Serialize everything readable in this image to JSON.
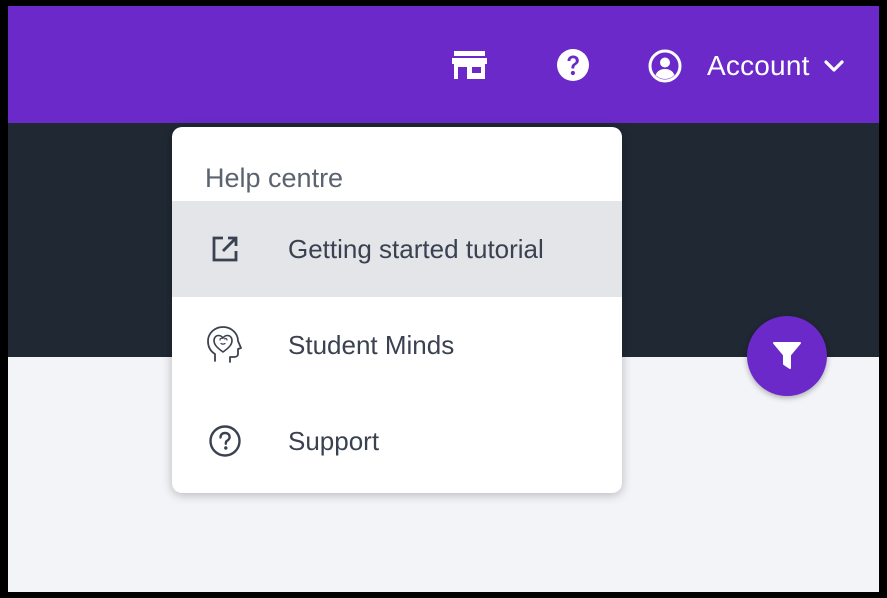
{
  "header": {
    "account_label": "Account",
    "icons": [
      "store-icon",
      "help-circle-icon",
      "account-circle-icon",
      "chevron-down-icon"
    ]
  },
  "help_menu": {
    "title": "Help centre",
    "items": [
      {
        "label": "Getting started tutorial",
        "icon": "external-link-icon",
        "active": true
      },
      {
        "label": "Student Minds",
        "icon": "head-heart-icon",
        "active": false
      },
      {
        "label": "Support",
        "icon": "question-circle-icon",
        "active": false
      }
    ]
  },
  "fab": {
    "icon": "filter-icon"
  },
  "colors": {
    "header_bg": "#6a29c8",
    "dark_band": "#1f2833",
    "page_bg": "#f3f4f8",
    "active_item_bg": "#e3e5e9"
  }
}
